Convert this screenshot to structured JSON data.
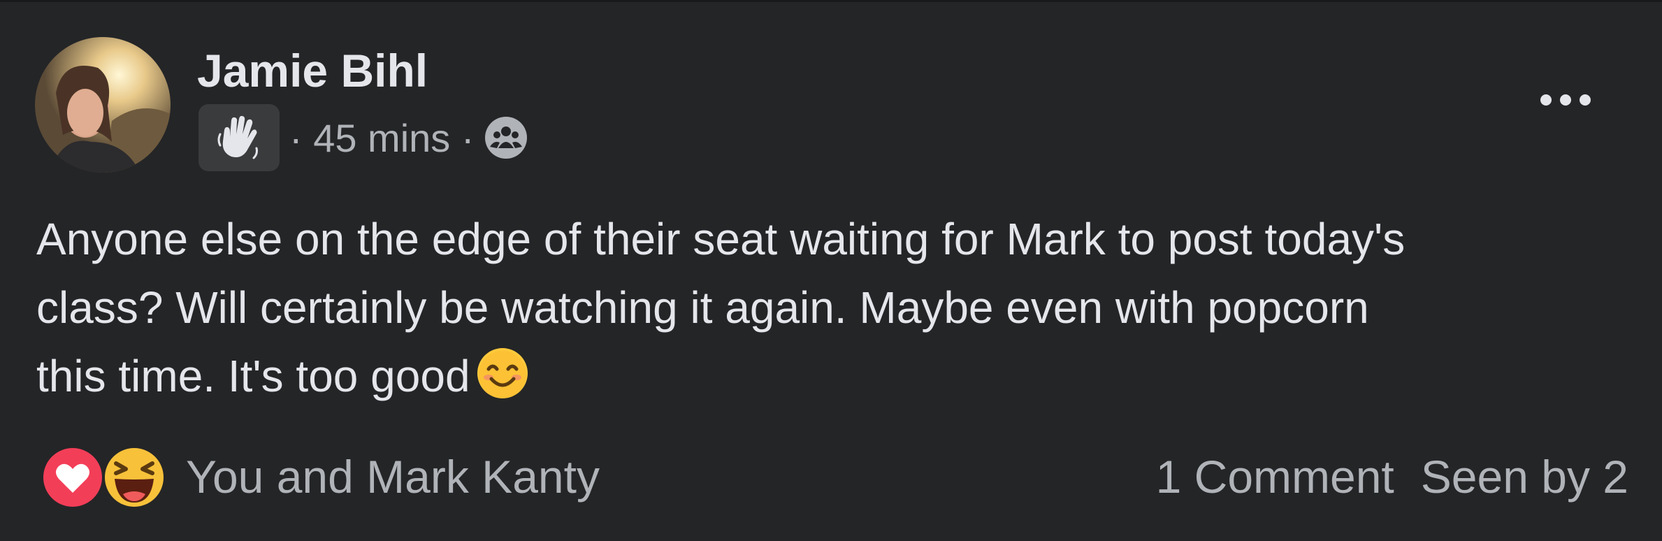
{
  "post": {
    "author": "Jamie Bihl",
    "time": "· 45 mins ·",
    "badge_icon": "wave-hand-icon",
    "audience_icon": "group-icon",
    "menu_icon": "more-options-icon",
    "text_lines": [
      "Anyone else on the edge of their seat waiting for Mark to post today's",
      "class?  Will certainly be watching it again.  Maybe even with popcorn",
      "this time.  It's too good"
    ],
    "emoji": "smiling-face-icon"
  },
  "reactions": {
    "icons": [
      "love-icon",
      "haha-icon"
    ],
    "summary": "You and Mark Kanty"
  },
  "stats": {
    "comments": "1 Comment",
    "seen": "Seen by 2"
  },
  "colors": {
    "background": "#242527",
    "primary_text": "#e4e6eb",
    "secondary_text": "#b0b3b8",
    "love": "#f33e58",
    "haha": "#f7b125"
  }
}
